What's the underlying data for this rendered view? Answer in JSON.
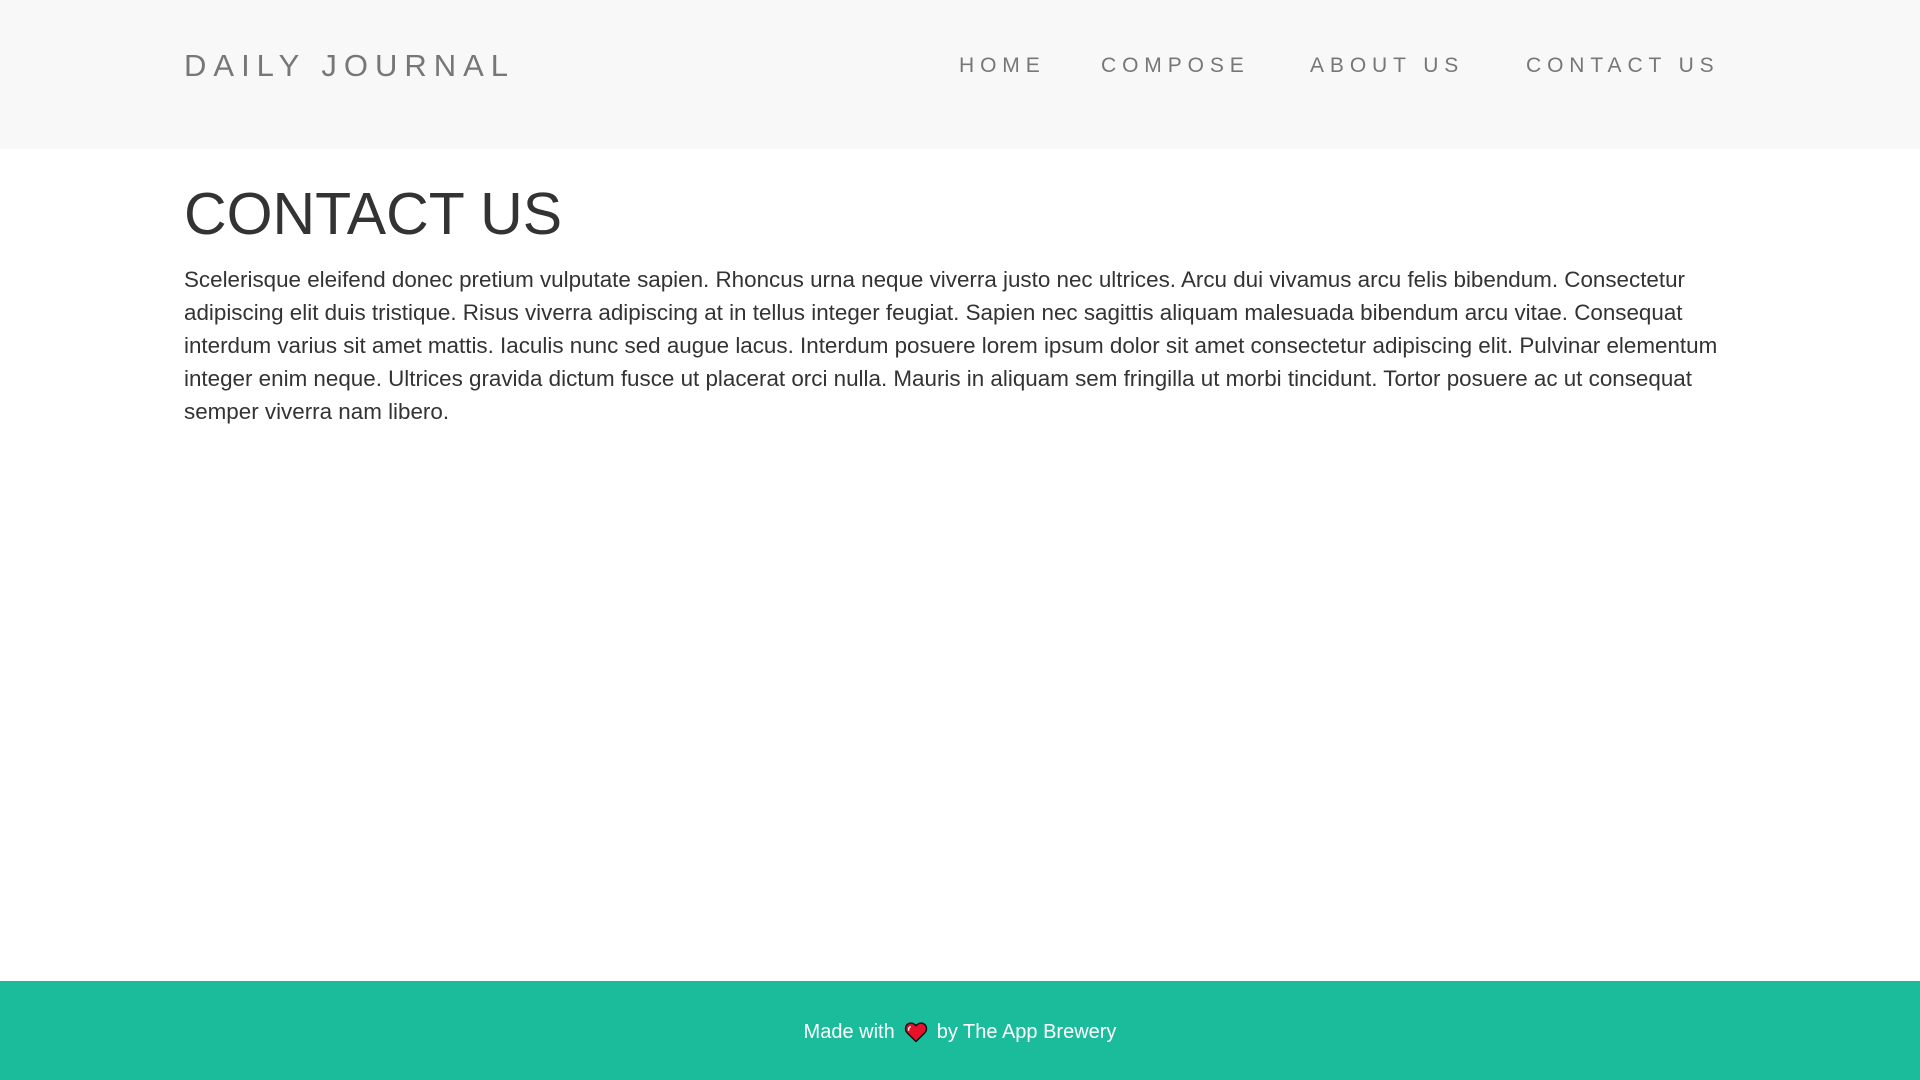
{
  "navbar": {
    "brand": "DAILY JOURNAL",
    "links": [
      {
        "label": "HOME"
      },
      {
        "label": "COMPOSE"
      },
      {
        "label": "ABOUT US"
      },
      {
        "label": "CONTACT US"
      }
    ]
  },
  "main": {
    "title": "CONTACT US",
    "body": "Scelerisque eleifend donec pretium vulputate sapien. Rhoncus urna neque viverra justo nec ultrices. Arcu dui vivamus arcu felis bibendum. Consectetur adipiscing elit duis tristique. Risus viverra adipiscing at in tellus integer feugiat. Sapien nec sagittis aliquam malesuada bibendum arcu vitae. Consequat interdum varius sit amet mattis. Iaculis nunc sed augue lacus. Interdum posuere lorem ipsum dolor sit amet consectetur adipiscing elit. Pulvinar elementum integer enim neque. Ultrices gravida dictum fusce ut placerat orci nulla. Mauris in aliquam sem fringilla ut morbi tincidunt. Tortor posuere ac ut consequat semper viverra nam libero."
  },
  "footer": {
    "prefix": "Made with",
    "icon": "heart-icon",
    "suffix": "by The App Brewery",
    "background_color": "#1abc9c",
    "heart_color": "#e8102a"
  },
  "colors": {
    "navbar_bg": "#f8f8f8",
    "nav_text": "#777777",
    "body_text": "#333333",
    "page_bg": "#ffffff"
  }
}
